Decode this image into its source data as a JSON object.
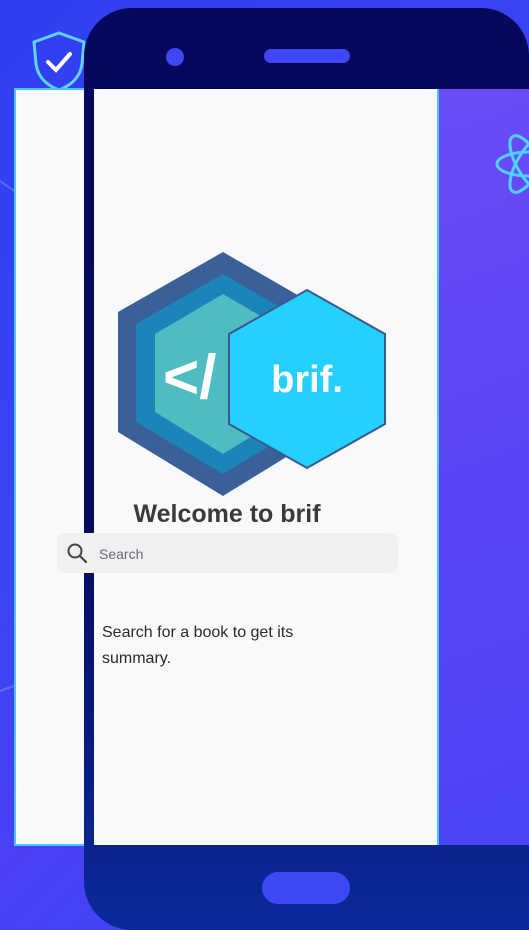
{
  "app": {
    "name": "brif"
  },
  "logo": {
    "code_glyph": "</",
    "wordmark": "brif."
  },
  "welcome": {
    "title": "Welcome to brif"
  },
  "search": {
    "placeholder": "Search",
    "value": ""
  },
  "hint": {
    "text": "Search for a book to get its summary."
  },
  "colors": {
    "background": "#3a44f5",
    "phone_frame": "#07095e",
    "accent": "#3d48f4",
    "hex_outer": "#3b5f99",
    "hex_mid": "#1b84b8",
    "hex_inner": "#4fbcc4",
    "hex_badge": "#24d0ff"
  },
  "icons": [
    "shield-icon",
    "atom-icon",
    "search-icon"
  ]
}
